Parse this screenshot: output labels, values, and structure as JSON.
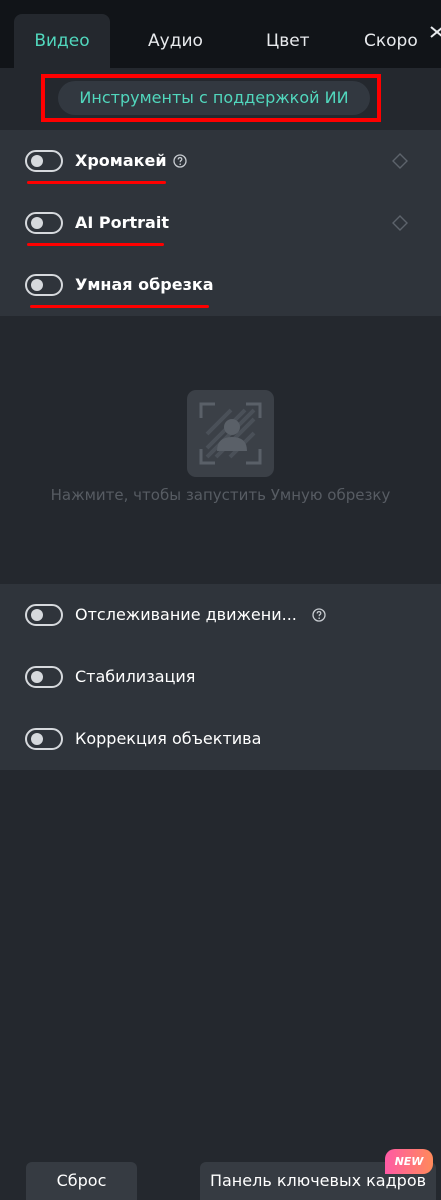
{
  "tabs": [
    {
      "label": "Видео",
      "active": true
    },
    {
      "label": "Аудио",
      "active": false
    },
    {
      "label": "Цвет",
      "active": false
    },
    {
      "label": "Скоро",
      "active": false
    }
  ],
  "ai_tools": {
    "label": "Инструменты с поддержкой ИИ"
  },
  "features_top": [
    {
      "label": "Хромакей",
      "enabled": false,
      "help": true,
      "keyframe": true
    },
    {
      "label": "AI Portrait",
      "enabled": false,
      "help": false,
      "keyframe": true
    },
    {
      "label": "Умная обрезка",
      "enabled": false,
      "help": false,
      "keyframe": false
    }
  ],
  "smart_crop": {
    "hint": "Нажмите, чтобы запустить Умную обрезку"
  },
  "features_bottom": [
    {
      "label": "Отслеживание движени...",
      "enabled": false,
      "help": true
    },
    {
      "label": "Стабилизация",
      "enabled": false,
      "help": false
    },
    {
      "label": "Коррекция объектива",
      "enabled": false,
      "help": false
    }
  ],
  "footer": {
    "reset_label": "Сброс",
    "keyframes_label": "Панель ключевых кадров",
    "new_badge": "NEW"
  },
  "colors": {
    "accent": "#51d7bd",
    "highlight": "#ff0000",
    "panel": "#2f343b",
    "background": "#24282e"
  }
}
